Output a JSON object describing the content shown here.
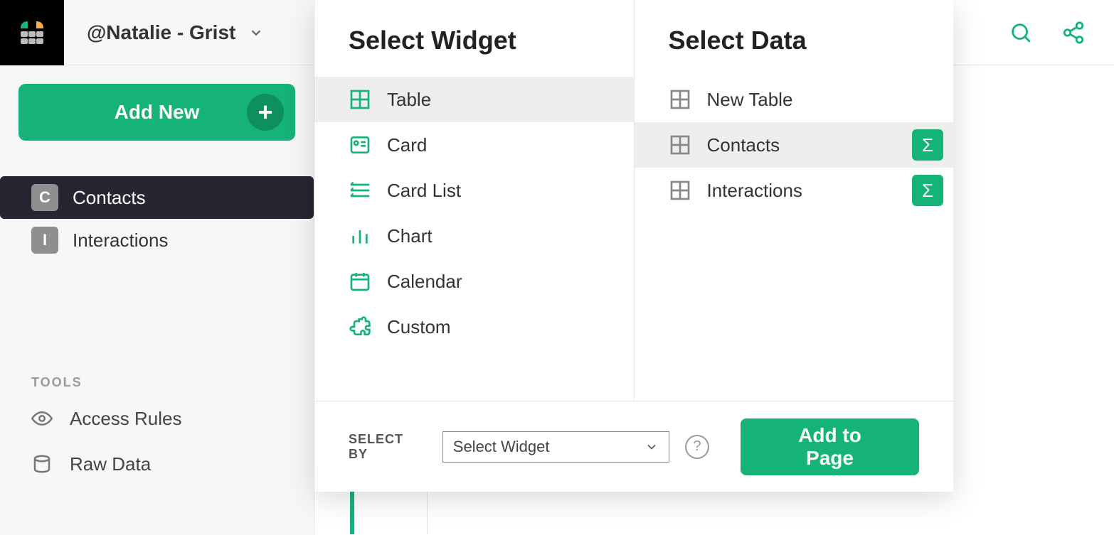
{
  "doc": {
    "name": "@Natalie - Grist"
  },
  "sidebar": {
    "add_new_label": "Add New",
    "pages": [
      {
        "initial": "C",
        "label": "Contacts",
        "active": true
      },
      {
        "initial": "I",
        "label": "Interactions",
        "active": false
      }
    ],
    "tools_header": "TOOLS",
    "tools": [
      {
        "icon": "eye",
        "label": "Access Rules"
      },
      {
        "icon": "cylinder",
        "label": "Raw Data"
      }
    ]
  },
  "modal": {
    "widget_header": "Select Widget",
    "data_header": "Select Data",
    "widgets": [
      {
        "icon": "grid",
        "label": "Table",
        "selected": true
      },
      {
        "icon": "card",
        "label": "Card",
        "selected": false
      },
      {
        "icon": "cardlist",
        "label": "Card List",
        "selected": false
      },
      {
        "icon": "chart",
        "label": "Chart",
        "selected": false
      },
      {
        "icon": "calendar",
        "label": "Calendar",
        "selected": false
      },
      {
        "icon": "puzzle",
        "label": "Custom",
        "selected": false
      }
    ],
    "data_options": [
      {
        "label": "New Table",
        "selected": false,
        "sigma": false
      },
      {
        "label": "Contacts",
        "selected": true,
        "sigma": true
      },
      {
        "label": "Interactions",
        "selected": false,
        "sigma": true
      }
    ],
    "footer": {
      "select_by_label": "SELECT BY",
      "select_value": "Select Widget",
      "submit_label": "Add to Page"
    }
  }
}
